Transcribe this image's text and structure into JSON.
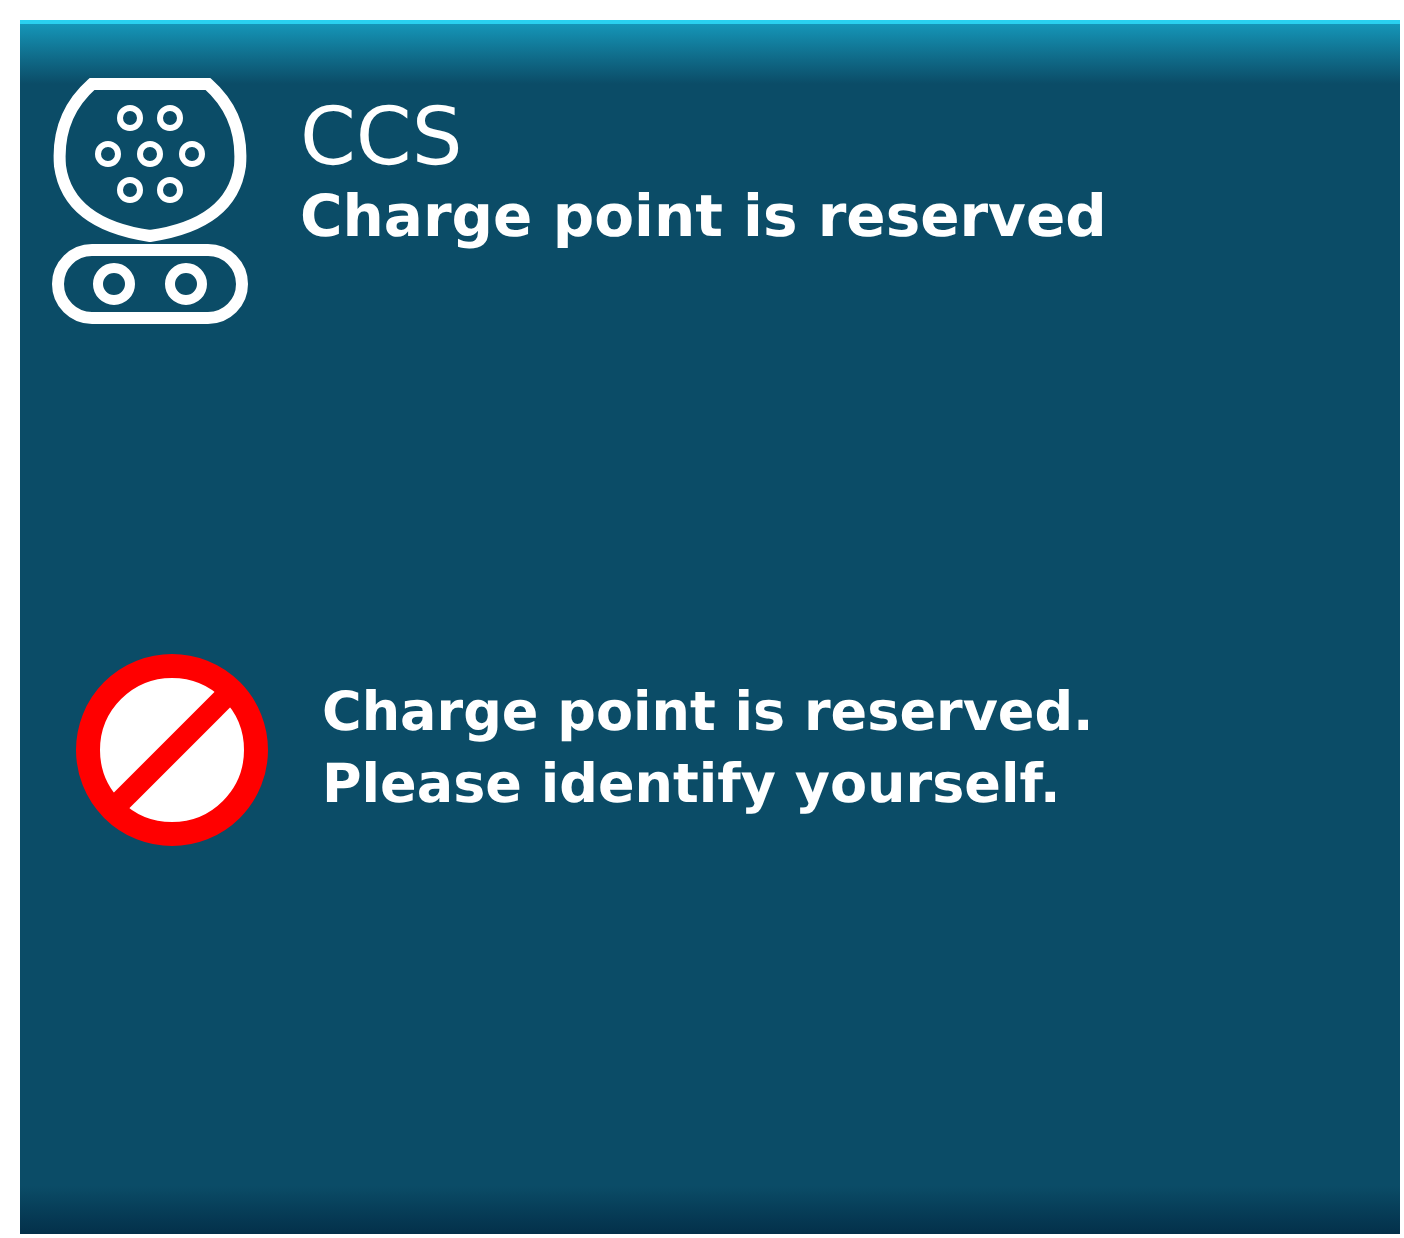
{
  "connector": {
    "name": "CCS",
    "status": "Charge point is reserved"
  },
  "message": {
    "kind": "prohibited",
    "lines": [
      "Charge point is reserved.",
      "Please identify yourself."
    ]
  }
}
